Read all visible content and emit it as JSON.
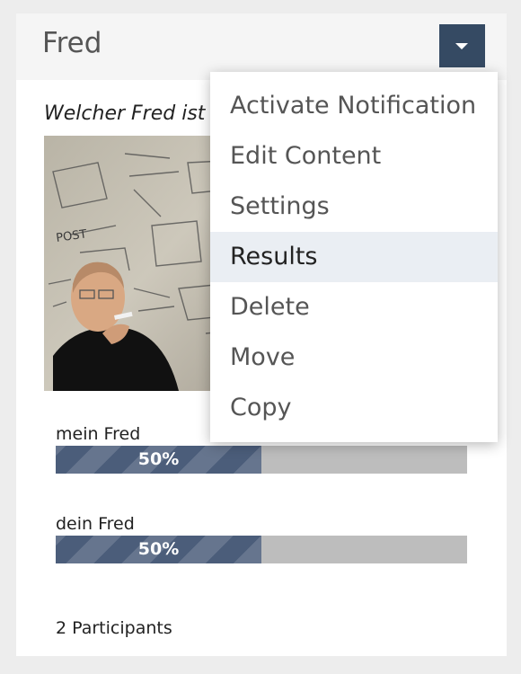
{
  "header": {
    "title": "Fred"
  },
  "poll": {
    "question": "Welcher Fred ist",
    "answers": [
      {
        "label": "mein Fred",
        "percent": 50,
        "percent_label": "50%"
      },
      {
        "label": "dein Fred",
        "percent": 50,
        "percent_label": "50%"
      }
    ],
    "participants": "2 Participants"
  },
  "menu": {
    "items": [
      {
        "label": "Activate Notification",
        "active": false
      },
      {
        "label": "Edit Content",
        "active": false
      },
      {
        "label": "Settings",
        "active": false
      },
      {
        "label": "Results",
        "active": true
      },
      {
        "label": "Delete",
        "active": false
      },
      {
        "label": "Move",
        "active": false
      },
      {
        "label": "Copy",
        "active": false
      }
    ]
  },
  "colors": {
    "toggle_bg": "#354a63",
    "bar_fill": "#4b5d7a",
    "bar_track": "#bdbdbd",
    "menu_active": "#eaeef3"
  },
  "icons": {
    "toggle": "caret-down-icon"
  }
}
